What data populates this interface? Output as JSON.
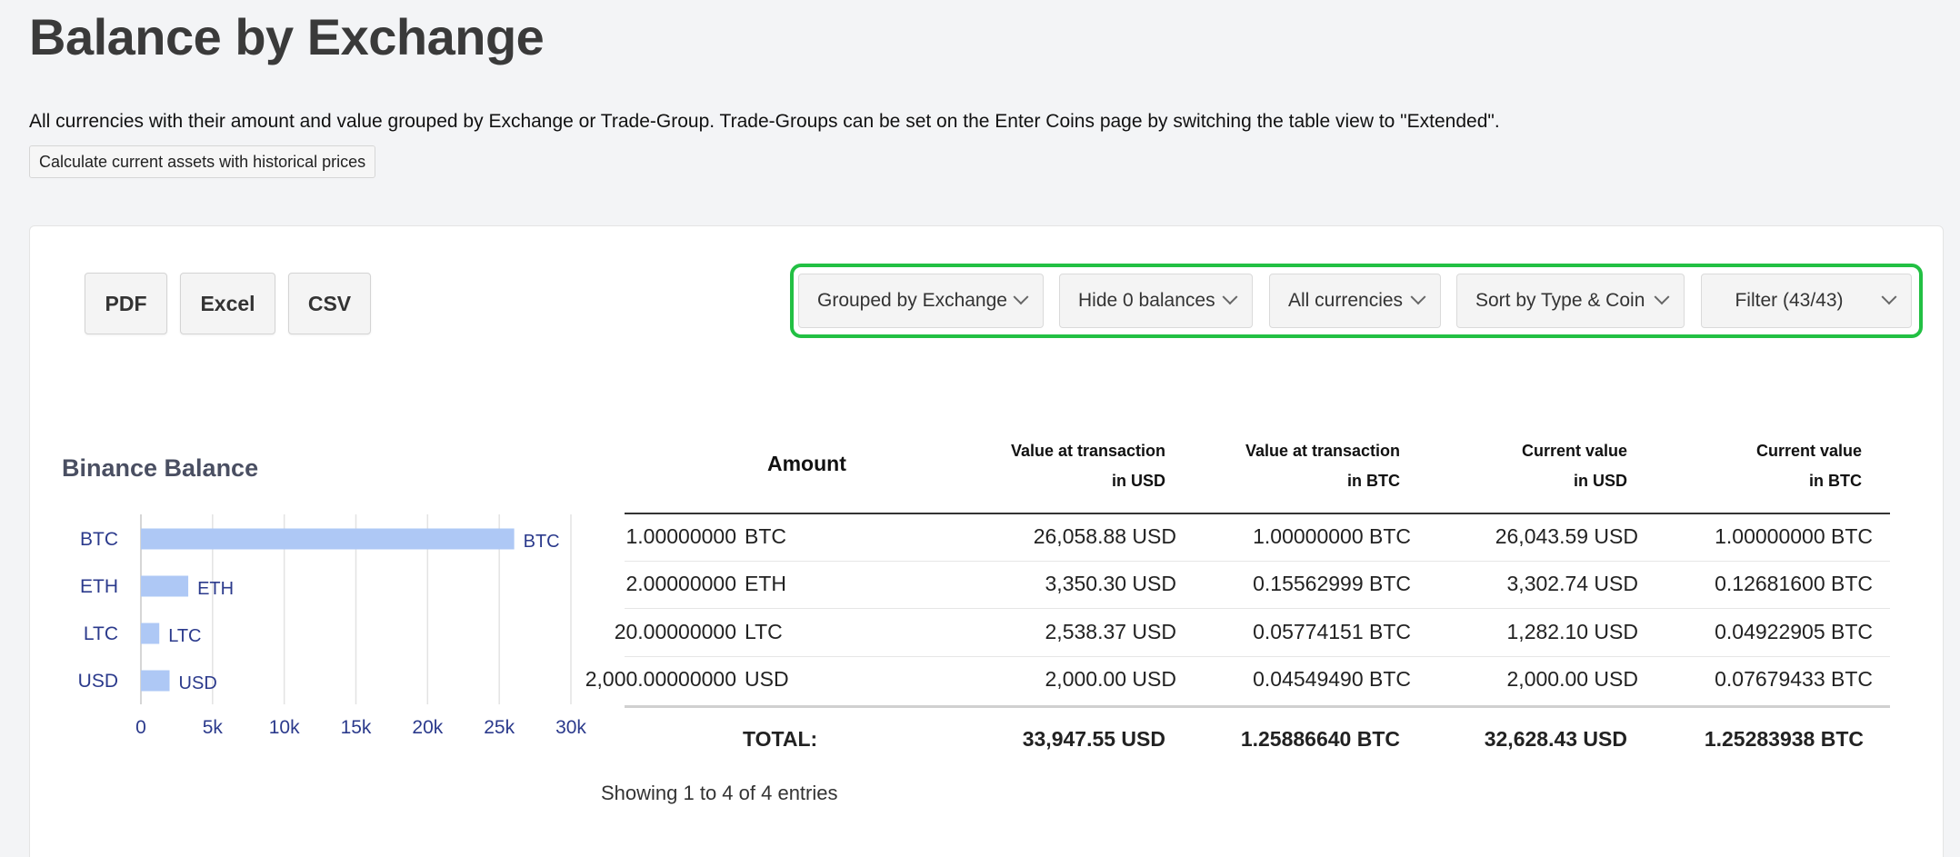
{
  "page": {
    "title": "Balance by Exchange",
    "description": "All currencies with their amount and value grouped by Exchange or Trade-Group. Trade-Groups can be set on the Enter Coins page by switching the table view to \"Extended\".",
    "historical_button": "Calculate current assets with historical prices"
  },
  "export_buttons": [
    "PDF",
    "Excel",
    "CSV"
  ],
  "filters": {
    "group_by": "Grouped by Exchange",
    "hide_zero": "Hide 0 balances",
    "currencies": "All currencies",
    "sort": "Sort by Type & Coin",
    "filter": "Filter (43/43)"
  },
  "colors": {
    "highlight": "#22c043",
    "bar": "#aec8f5",
    "axis_text": "#2b3a8c"
  },
  "chart_title": "Binance Balance",
  "chart_data": {
    "type": "bar",
    "orientation": "horizontal",
    "title": "Binance Balance",
    "categories": [
      "BTC",
      "ETH",
      "LTC",
      "USD"
    ],
    "values": [
      26043.59,
      3302.74,
      1282.1,
      2000.0
    ],
    "bar_labels": [
      "BTC",
      "ETH",
      "LTC",
      "USD"
    ],
    "xlim": [
      0,
      30000
    ],
    "xticks": [
      0,
      5000,
      10000,
      15000,
      20000,
      25000,
      30000
    ],
    "xtick_labels": [
      "0",
      "5k",
      "10k",
      "15k",
      "20k",
      "25k",
      "30k"
    ],
    "grid": true,
    "xlabel": "",
    "ylabel": ""
  },
  "table": {
    "headers": {
      "amount": "Amount",
      "val_tx_usd": [
        "Value at transaction",
        "in USD"
      ],
      "val_tx_btc": [
        "Value at transaction",
        "in BTC"
      ],
      "cur_usd": [
        "Current value",
        "in USD"
      ],
      "cur_btc": [
        "Current value",
        "in BTC"
      ]
    },
    "rows": [
      {
        "amount": "1.00000000",
        "coin": "BTC",
        "val_tx_usd": "26,058.88 USD",
        "val_tx_btc": "1.00000000 BTC",
        "cur_usd": "26,043.59 USD",
        "cur_btc": "1.00000000 BTC"
      },
      {
        "amount": "2.00000000",
        "coin": "ETH",
        "val_tx_usd": "3,350.30 USD",
        "val_tx_btc": "0.15562999 BTC",
        "cur_usd": "3,302.74 USD",
        "cur_btc": "0.12681600 BTC"
      },
      {
        "amount": "20.00000000",
        "coin": "LTC",
        "val_tx_usd": "2,538.37 USD",
        "val_tx_btc": "0.05774151 BTC",
        "cur_usd": "1,282.10 USD",
        "cur_btc": "0.04922905 BTC"
      },
      {
        "amount": "2,000.00000000",
        "coin": "USD",
        "val_tx_usd": "2,000.00 USD",
        "val_tx_btc": "0.04549490 BTC",
        "cur_usd": "2,000.00 USD",
        "cur_btc": "0.07679433 BTC"
      }
    ],
    "total": {
      "label": "TOTAL:",
      "val_tx_usd": "33,947.55 USD",
      "val_tx_btc": "1.25886640 BTC",
      "cur_usd": "32,628.43 USD",
      "cur_btc": "1.25283938 BTC"
    },
    "info": "Showing 1 to 4 of 4 entries"
  }
}
